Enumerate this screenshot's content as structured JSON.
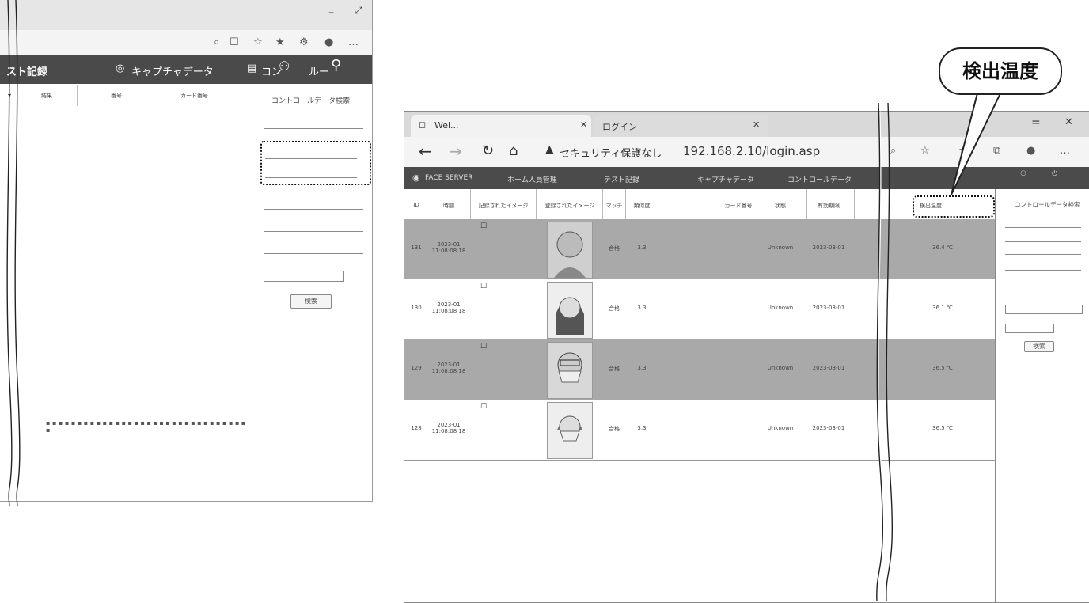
{
  "callout": {
    "label": "検出温度"
  },
  "left_window": {
    "nav": {
      "item1": "スト記録",
      "item2": "キャプチャデータ",
      "item3": "コン",
      "item4": "ルー"
    },
    "columns": [
      "結果",
      "番号",
      "カード番号"
    ],
    "sidebar": {
      "title": "コントロールデータ検索",
      "button": "検索"
    }
  },
  "right_window": {
    "tabs": [
      {
        "label": "Wel..."
      },
      {
        "label": "ログイン"
      }
    ],
    "address": {
      "security_label": "セキュリティ保護なし",
      "url": "192.168.2.10/login.asp"
    },
    "nav": {
      "logo": "FACE SERVER",
      "items": [
        "ホーム人員管理",
        "テスト記録",
        "キャプチャデータ",
        "コントロールデータ"
      ]
    },
    "table": {
      "headers": [
        "ID",
        "時間",
        "記録されたイメージ",
        "登録されたイメージ",
        "マッチ",
        "類似度",
        "",
        "カード番号",
        "状態",
        "有効期限",
        "",
        "検出温度"
      ],
      "rows": [
        {
          "id": "131",
          "time": "2023-01\n11:08:08 18",
          "match": "合格",
          "similarity": "3.3",
          "status": "Unknown",
          "date": "2023-03-01",
          "temp": "36.4 ℃"
        },
        {
          "id": "130",
          "time": "2023-01\n11:08:08 18",
          "match": "合格",
          "similarity": "3.3",
          "status": "Unknown",
          "date": "2023-03-01",
          "temp": "36.1 ℃"
        },
        {
          "id": "129",
          "time": "2023-01\n11:08:08 18",
          "match": "合格",
          "similarity": "3.3",
          "status": "Unknown",
          "date": "2023-03-01",
          "temp": "36.5 ℃"
        },
        {
          "id": "128",
          "time": "2023-01\n11:08:08 18",
          "match": "合格",
          "similarity": "3.3",
          "status": "Unknown",
          "date": "2023-03-01",
          "temp": "36.5 ℃"
        }
      ]
    },
    "sidebar": {
      "title": "コントロールデータ検索",
      "button": "検索"
    }
  }
}
